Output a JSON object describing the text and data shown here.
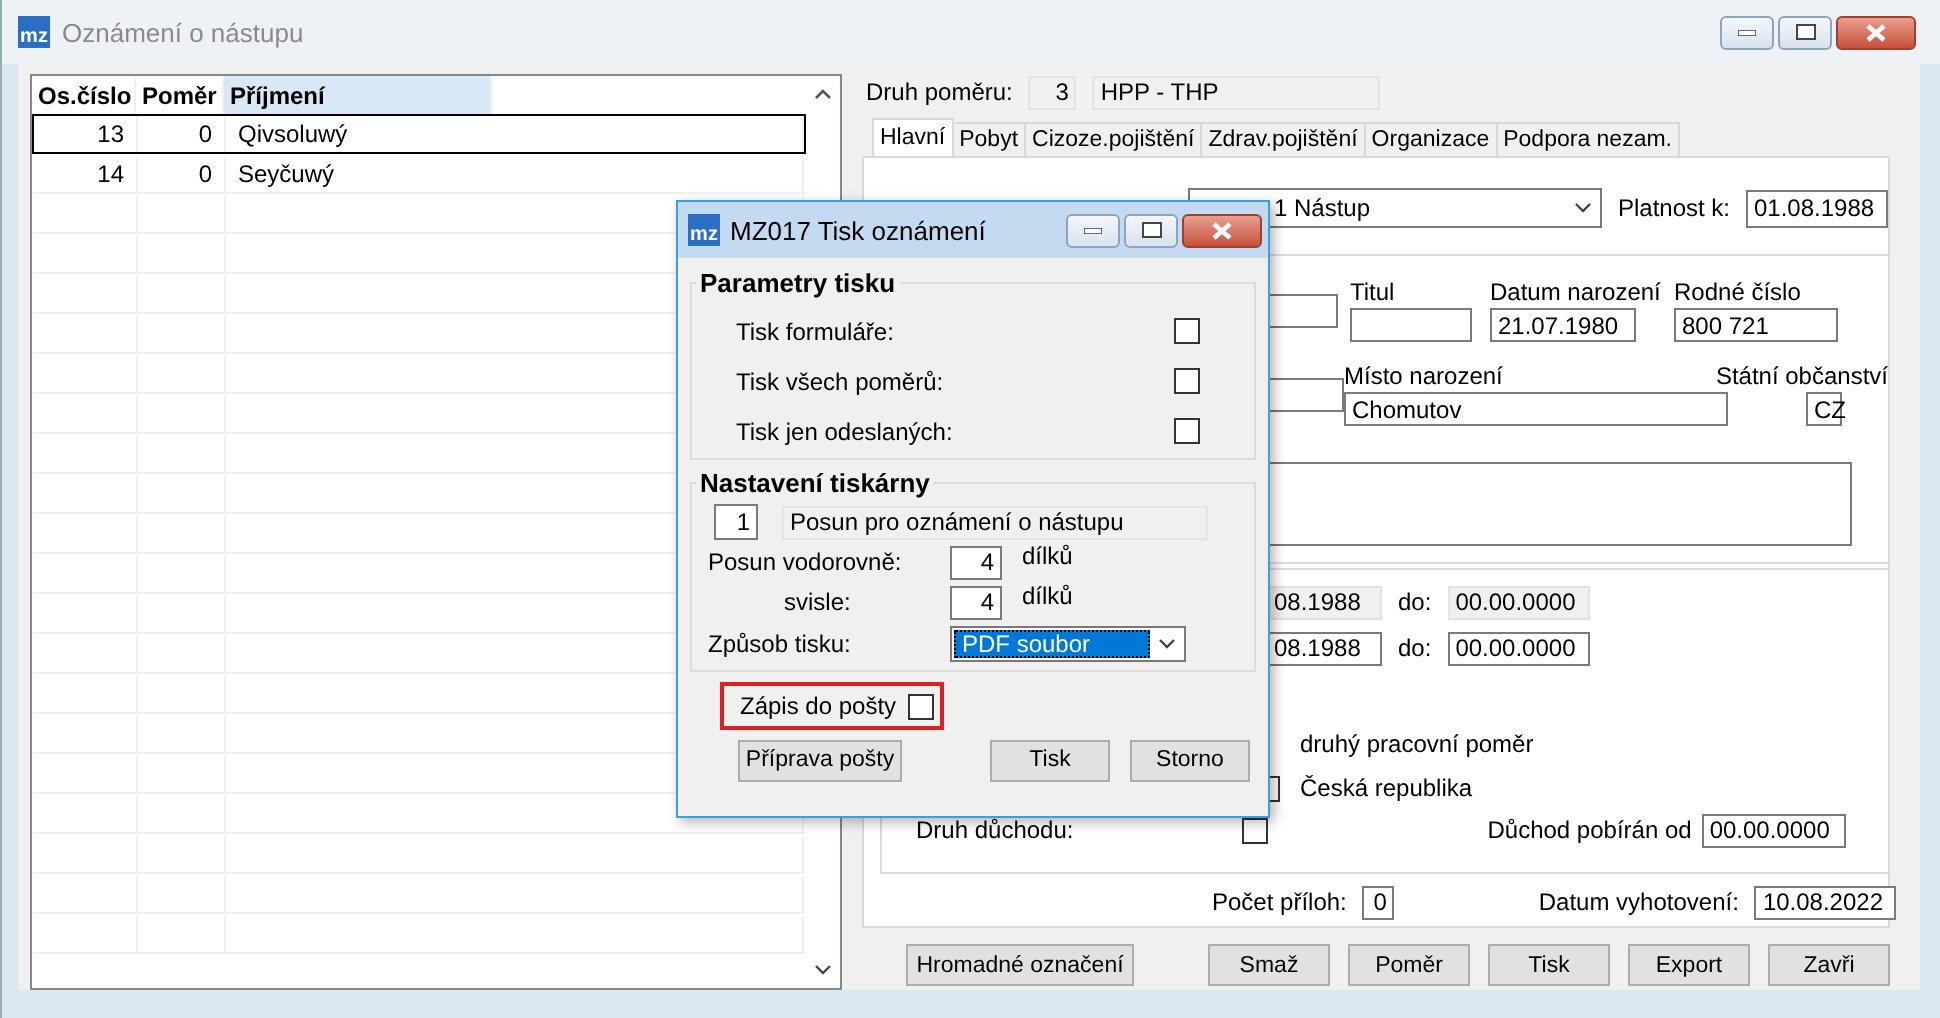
{
  "window": {
    "logo": "mz",
    "title": "Oznámení o nástupu"
  },
  "list": {
    "columns": [
      {
        "label": "Os.číslo",
        "sorted": false
      },
      {
        "label": "Poměr",
        "sorted": false
      },
      {
        "label": "Příjmení",
        "sorted": true
      }
    ],
    "rows": [
      {
        "cells": [
          "13",
          "0",
          "Qivsoluwý"
        ],
        "selected": true
      },
      {
        "cells": [
          "14",
          "0",
          "Seyčuwý"
        ],
        "selected": false
      }
    ]
  },
  "relation": {
    "label": "Druh poměru:",
    "code": "3",
    "name": "HPP - THP"
  },
  "tabs": [
    {
      "label": "Hlavní",
      "selected": true
    },
    {
      "label": "Pobyt",
      "selected": false
    },
    {
      "label": "Cizoze.pojištění",
      "selected": false
    },
    {
      "label": "Zdrav.pojištění",
      "selected": false
    },
    {
      "label": "Organizace",
      "selected": false
    },
    {
      "label": "Podpora nezam.",
      "selected": false
    }
  ],
  "form": {
    "event": "1 Nástup",
    "validity": {
      "label": "Platnost k:",
      "value": "01.08.1988"
    },
    "person": {
      "title": {
        "label": "Titul"
      },
      "birth_date": {
        "label": "Datum narození",
        "value": "21.07.1980"
      },
      "birth_number": {
        "label": "Rodné číslo",
        "value": "800 721"
      },
      "birth_place": {
        "label": "Místo narození",
        "value": "Chomutov"
      },
      "citizenship": {
        "label": "Státní občanství",
        "value": "CZ"
      }
    },
    "periods": [
      {
        "from": "08.1988",
        "to_label": "do:",
        "to": "00.00.0000",
        "readonly": true
      },
      {
        "from": "08.1988",
        "to_label": "do:",
        "to": "00.00.0000",
        "readonly": false
      }
    ],
    "second_job": "druhý pracovní poměr",
    "country": "Česká republika",
    "country_checked": false,
    "pension_type": {
      "label": "Druh důchodu:",
      "checked": false
    },
    "pension_from": {
      "label": "Důchod pobírán od",
      "value": "00.00.0000"
    },
    "attachments": {
      "label": "Počet příloh:",
      "value": "0"
    },
    "issued": {
      "label": "Datum vyhotovení:",
      "value": "10.08.2022"
    }
  },
  "buttons": [
    "Hromadné označení",
    "Smaž",
    "Poměr",
    "Tisk",
    "Export",
    "Zavři"
  ],
  "dialog": {
    "logo": "mz",
    "title": "MZ017 Tisk oznámení",
    "params": {
      "title": "Parametry tisku",
      "options": [
        {
          "label": "Tisk formuláře:",
          "checked": false
        },
        {
          "label": "Tisk všech poměrů:",
          "checked": false
        },
        {
          "label": "Tisk jen odeslaných:",
          "checked": false
        }
      ]
    },
    "printer": {
      "title": "Nastavení tiskárny",
      "profile_number": "1",
      "profile_name": "Posun pro oznámení o nástupu",
      "horizontal": {
        "label": "Posun vodorovně:",
        "value": "4",
        "unit": "dílků"
      },
      "vertical": {
        "label": "svisle:",
        "value": "4",
        "unit": "dílků"
      },
      "mode": {
        "label": "Způsob tisku:",
        "value": "PDF soubor"
      }
    },
    "mail": {
      "label": "Zápis do pošty",
      "checked": false,
      "highlighted": true
    },
    "buttons": [
      "Příprava pošty",
      "Tisk",
      "Storno"
    ]
  }
}
